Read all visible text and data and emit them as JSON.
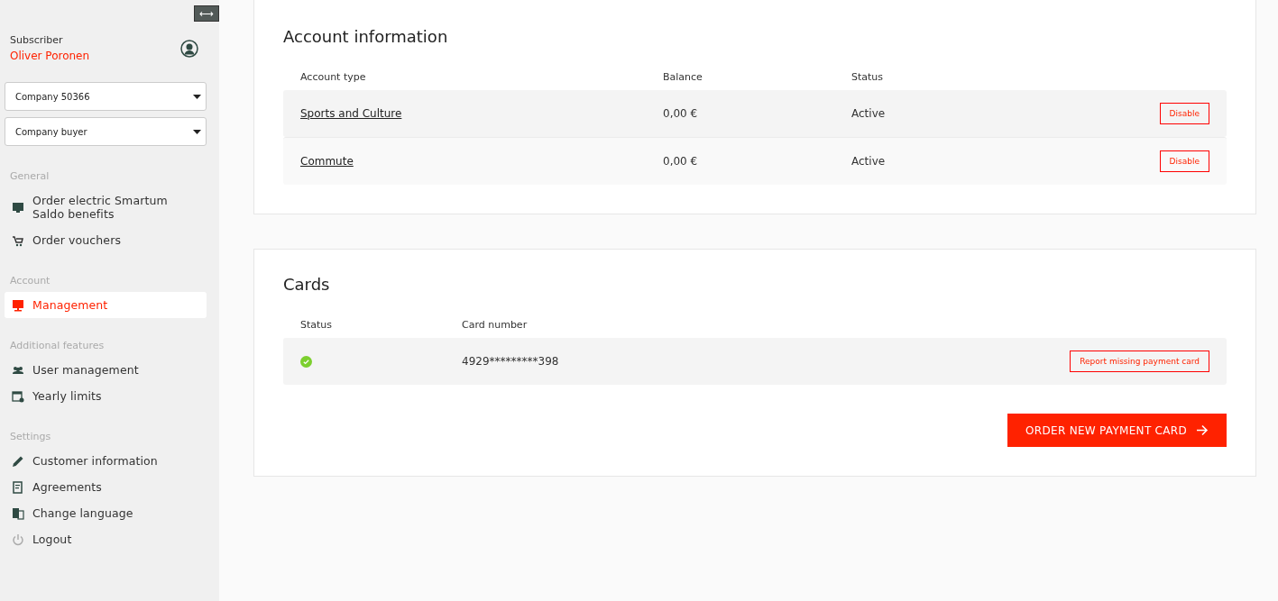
{
  "sidebar": {
    "toggle": "⟷",
    "subscriber_label": "Subscriber",
    "subscriber_name": "Oliver Poronen",
    "selects": [
      {
        "value": "Company 50366"
      },
      {
        "value": "Company buyer"
      }
    ],
    "sections": [
      {
        "title": "General",
        "items": [
          {
            "label": "Order electric Smartum Saldo benefits",
            "selected": false
          },
          {
            "label": "Order vouchers",
            "selected": false
          }
        ]
      },
      {
        "title": "Account",
        "items": [
          {
            "label": "Management",
            "selected": true
          }
        ]
      },
      {
        "title": "Additional features",
        "items": [
          {
            "label": "User management",
            "selected": false
          },
          {
            "label": "Yearly limits",
            "selected": false
          }
        ]
      },
      {
        "title": "Settings",
        "items": [
          {
            "label": "Customer information",
            "selected": false
          },
          {
            "label": "Agreements",
            "selected": false
          },
          {
            "label": "Change language",
            "selected": false
          },
          {
            "label": "Logout",
            "selected": false
          }
        ]
      }
    ]
  },
  "account_information": {
    "title": "Account information",
    "columns": [
      "Account type",
      "Balance",
      "Status"
    ],
    "rows": [
      {
        "account_type": "Sports and Culture",
        "balance": "0,00 €",
        "status": "Active",
        "action": "Disable"
      },
      {
        "account_type": "Commute",
        "balance": "0,00 €",
        "status": "Active",
        "action": "Disable"
      }
    ]
  },
  "cards": {
    "title": "Cards",
    "columns": [
      "Status",
      "Card number"
    ],
    "rows": [
      {
        "active": true,
        "card_number": "4929*********398",
        "action": "Report missing payment card"
      }
    ],
    "order_button": "ORDER NEW PAYMENT CARD"
  }
}
